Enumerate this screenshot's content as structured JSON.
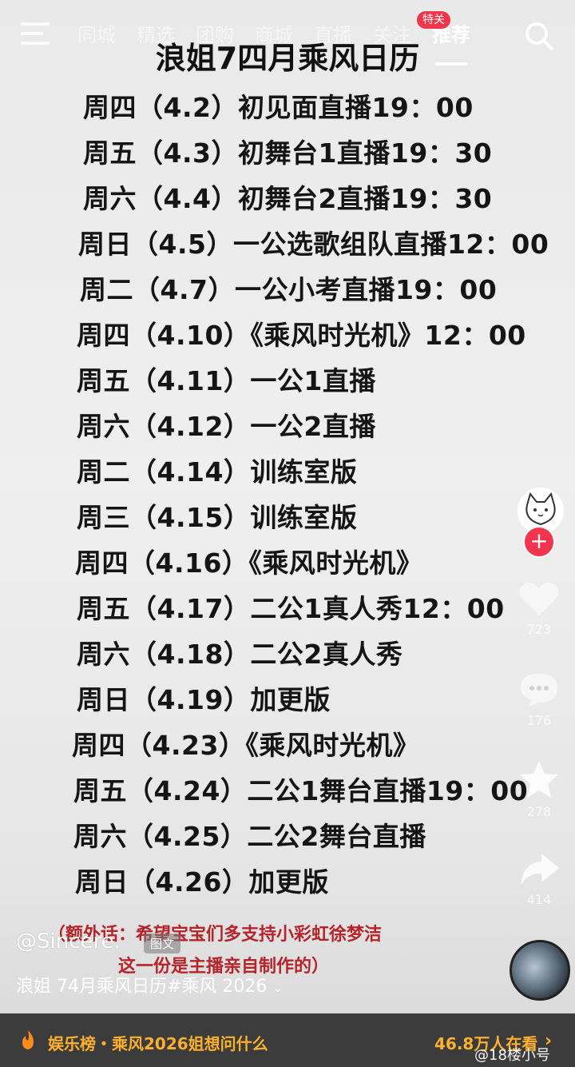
{
  "topnav": {
    "tabs": [
      "同城",
      "精选",
      "团购",
      "商城",
      "直播",
      "关注",
      "推荐"
    ],
    "active_tab": "推荐",
    "badge": "特关"
  },
  "poster": {
    "title": "浪姐7四月乘风日历",
    "rows": [
      "周四（4.2）初见面直播19：00",
      "周五（4.3）初舞台1直播19：30",
      "周六（4.4）初舞台2直播19：30",
      "周日（4.5）一公选歌组队直播12：00",
      "周二（4.7）一公小考直播19：00",
      "周四（4.10）《乘风时光机》12：00",
      "周五（4.11）一公1直播",
      "周六（4.12）一公2直播",
      "周二（4.14）训练室版",
      "周三（4.15）训练室版",
      "周四（4.16）《乘风时光机》",
      "周五（4.17）二公1真人秀12：00",
      "周六（4.18）二公2真人秀",
      "周日（4.19）加更版",
      "周四（4.23）《乘风时光机》",
      "周五（4.24）二公1舞台直播19：00",
      "周六（4.25）二公2舞台直播",
      "周日（4.26）加更版"
    ],
    "note_line1": "（额外话：希望宝宝们多支持小彩虹徐梦洁",
    "note_line2": "这一份是主播亲自制作的）"
  },
  "rail": {
    "like_count": "723",
    "comment_count": "176",
    "favorite_count": "278",
    "share_count": "414"
  },
  "caption": {
    "author": "@Sincere.",
    "tag": "图文",
    "description": "浪姐 74月乘风日历#乘风 2026"
  },
  "bottom": {
    "hot_text": "娱乐榜・乘风2026姐想问什么",
    "viewers": "46.8万人在看",
    "watermark": "@18楼小号"
  },
  "colors": {
    "accent": "#f2354f",
    "hot": "#ffb02e",
    "note": "#b5242a"
  }
}
